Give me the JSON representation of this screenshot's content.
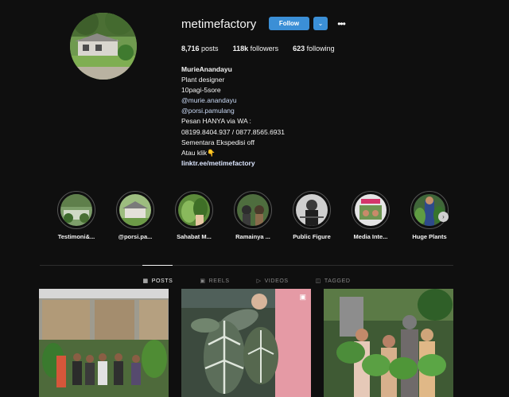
{
  "profile": {
    "username": "metimefactory",
    "follow_label": "Follow",
    "dropdown_icon": "chevron-down-icon",
    "more_icon": "more-horizontal-icon",
    "stats": {
      "posts_count": "8,716",
      "posts_label": "posts",
      "followers_count": "118k",
      "followers_label": "followers",
      "following_count": "623",
      "following_label": "following"
    },
    "bio": {
      "name": "MurieAnandayu",
      "line1": "Plant designer",
      "line2": "10pagi-5sore",
      "mention1": "@murie.anandayu",
      "mention2": "@porsi.pamulang",
      "line3": "Pesan HANYA via WA :",
      "line4": "08199.8404.937 / 0877.8565.6931",
      "line5": "Sementara Ekspedisi off",
      "line6": "Atau klik👇",
      "link": "linktr.ee/metimefactory"
    }
  },
  "highlights": [
    {
      "label": "Testimoni&..."
    },
    {
      "label": "@porsi.pa..."
    },
    {
      "label": "Sahabat M..."
    },
    {
      "label": "Ramainya ..."
    },
    {
      "label": "Public Figure"
    },
    {
      "label": "Media Inte..."
    },
    {
      "label": "Huge Plants"
    }
  ],
  "tabs": [
    {
      "label": "POSTS",
      "icon": "grid-icon",
      "active": true
    },
    {
      "label": "REELS",
      "icon": "reels-icon",
      "active": false
    },
    {
      "label": "VIDEOS",
      "icon": "play-icon",
      "active": false
    },
    {
      "label": "TAGGED",
      "icon": "tag-icon",
      "active": false
    }
  ],
  "colors": {
    "background": "#0f0f0f",
    "accent": "#3b8fd6",
    "text": "#f5f5f5",
    "muted": "#8a8a8a"
  }
}
